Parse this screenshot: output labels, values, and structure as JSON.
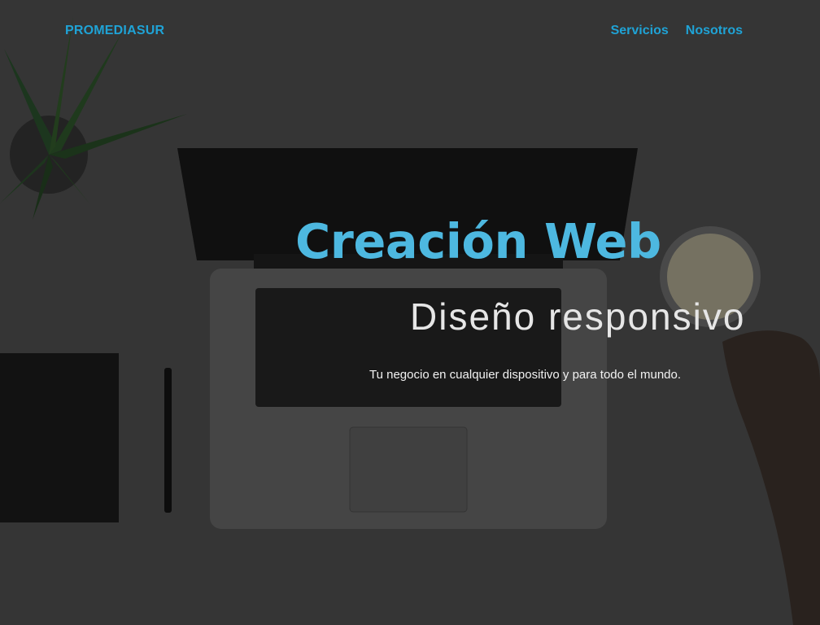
{
  "navbar": {
    "brand": "PROMEDIASUR",
    "links": [
      {
        "label": "Servicios"
      },
      {
        "label": "Nosotros"
      }
    ]
  },
  "hero": {
    "title": "Creación Web",
    "subtitle": "Diseño responsivo",
    "text": "Tu negocio en cualquier dispositivo y para todo el mundo."
  },
  "colors": {
    "accent": "#1fa3d6",
    "title": "#4db8e0",
    "background_overlay": "#3a3a3a"
  }
}
